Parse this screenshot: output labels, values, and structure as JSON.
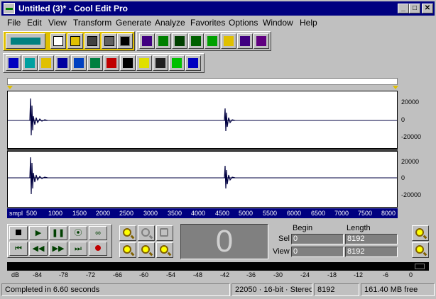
{
  "window": {
    "title": "Untitled (3)* - Cool Edit Pro",
    "minimize": "_",
    "maximize": "□",
    "close": "✕"
  },
  "menu": [
    "File",
    "Edit",
    "View",
    "Transform",
    "Generate",
    "Analyze",
    "Favorites",
    "Options",
    "Window",
    "Help"
  ],
  "toolbar_icons": {
    "row1": [
      "multitrack-toggle-icon",
      "new-file-icon",
      "open-file-icon",
      "save-icon",
      "save-all-icon",
      "cd-icon",
      "edit-icon",
      "effect1-icon",
      "effect2-icon",
      "effect3-icon",
      "waveform-icon",
      "effect5-icon",
      "effect6-icon",
      "effect7-icon"
    ],
    "row2": [
      "ap-icon",
      "noise-icon",
      "reverse-icon",
      "filter1-icon",
      "filter2-icon",
      "filter3-icon",
      "bars-icon",
      "kx-icon",
      "eq-icon",
      "sun-icon",
      "loop-icon",
      "ff-icon"
    ]
  },
  "channel_scale": [
    "20000",
    "0",
    "-20000"
  ],
  "ruler": {
    "unit": "smpl",
    "ticks": [
      "500",
      "1000",
      "1500",
      "2000",
      "2500",
      "3000",
      "3500",
      "4000",
      "4500",
      "5000",
      "5500",
      "6000",
      "6500",
      "7000",
      "7500",
      "8000"
    ]
  },
  "transport": {
    "row1": [
      "stop",
      "play",
      "pause",
      "play-to-end",
      "loop"
    ],
    "row2": [
      "go-to-start",
      "rewind",
      "fast-forward",
      "go-to-end",
      "record"
    ]
  },
  "time_display": "0",
  "selection": {
    "begin_header": "Begin",
    "length_header": "Length",
    "sel_label": "Sel",
    "view_label": "View",
    "sel_begin": "0",
    "sel_length": "8192",
    "view_begin": "0",
    "view_length": "8192"
  },
  "meter_scale": [
    "dB",
    "-84",
    "-78",
    "-72",
    "-66",
    "-60",
    "-54",
    "-48",
    "-42",
    "-36",
    "-30",
    "-24",
    "-18",
    "-12",
    "-6",
    "0"
  ],
  "status": {
    "message": "Completed in 6.60 seconds",
    "format": "22050 · 16-bit · Stereo",
    "size": "8192",
    "free": "161.40 MB free"
  },
  "colors": {
    "title_bar": "#000080",
    "waveform": "#000040",
    "ruler": "#000080",
    "toolbar_accent": "#e0c000"
  }
}
